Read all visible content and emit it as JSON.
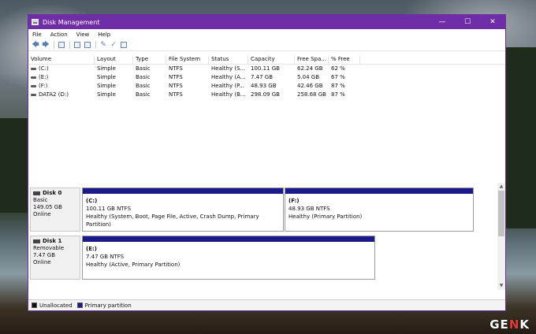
{
  "window": {
    "title": "Disk Management",
    "accent": "#6f2da8"
  },
  "menu": [
    "File",
    "Action",
    "View",
    "Help"
  ],
  "toolbar_icons": [
    "back-arrow-icon",
    "forward-arrow-icon",
    "console-tree-icon",
    "help-icon",
    "properties-icon",
    "rescan-disks-icon",
    "check-icon",
    "export-icon"
  ],
  "columns": [
    "Volume",
    "Layout",
    "Type",
    "File System",
    "Status",
    "Capacity",
    "Free Spa...",
    "% Free"
  ],
  "volumes": [
    {
      "volume": "(C:)",
      "layout": "Simple",
      "type": "Basic",
      "fs": "NTFS",
      "status": "Healthy (S...",
      "capacity": "100.11 GB",
      "free": "62.24 GB",
      "pct": "62 %"
    },
    {
      "volume": "(E:)",
      "layout": "Simple",
      "type": "Basic",
      "fs": "NTFS",
      "status": "Healthy (A...",
      "capacity": "7.47 GB",
      "free": "5.04 GB",
      "pct": "67 %"
    },
    {
      "volume": "(F:)",
      "layout": "Simple",
      "type": "Basic",
      "fs": "NTFS",
      "status": "Healthy (P...",
      "capacity": "48.93 GB",
      "free": "42.46 GB",
      "pct": "87 %"
    },
    {
      "volume": "DATA2 (D:)",
      "layout": "Simple",
      "type": "Basic",
      "fs": "NTFS",
      "status": "Healthy (B...",
      "capacity": "298.09 GB",
      "free": "258.68 GB",
      "pct": "87 %"
    }
  ],
  "disks": [
    {
      "name": "Disk 0",
      "type": "Basic",
      "size": "149.05 GB",
      "state": "Online",
      "partitions": [
        {
          "name": "(C:)",
          "size": "100.11 GB NTFS",
          "status": "Healthy (System, Boot, Page File, Active, Crash Dump, Primary Partition)"
        },
        {
          "name": "(F:)",
          "size": "48.93 GB NTFS",
          "status": "Healthy (Primary Partition)"
        }
      ]
    },
    {
      "name": "Disk 1",
      "type": "Removable",
      "size": "7.47 GB",
      "state": "Online",
      "partitions": [
        {
          "name": "(E:)",
          "size": "7.47 GB NTFS",
          "status": "Healthy (Active, Primary Partition)"
        }
      ]
    }
  ],
  "legend": {
    "unallocated": "Unallocated",
    "primary": "Primary partition",
    "unallocated_color": "#111111",
    "primary_color": "#1a1a8a"
  },
  "watermark": {
    "prefix": "GE",
    "accent": "N",
    "suffix": "K"
  }
}
